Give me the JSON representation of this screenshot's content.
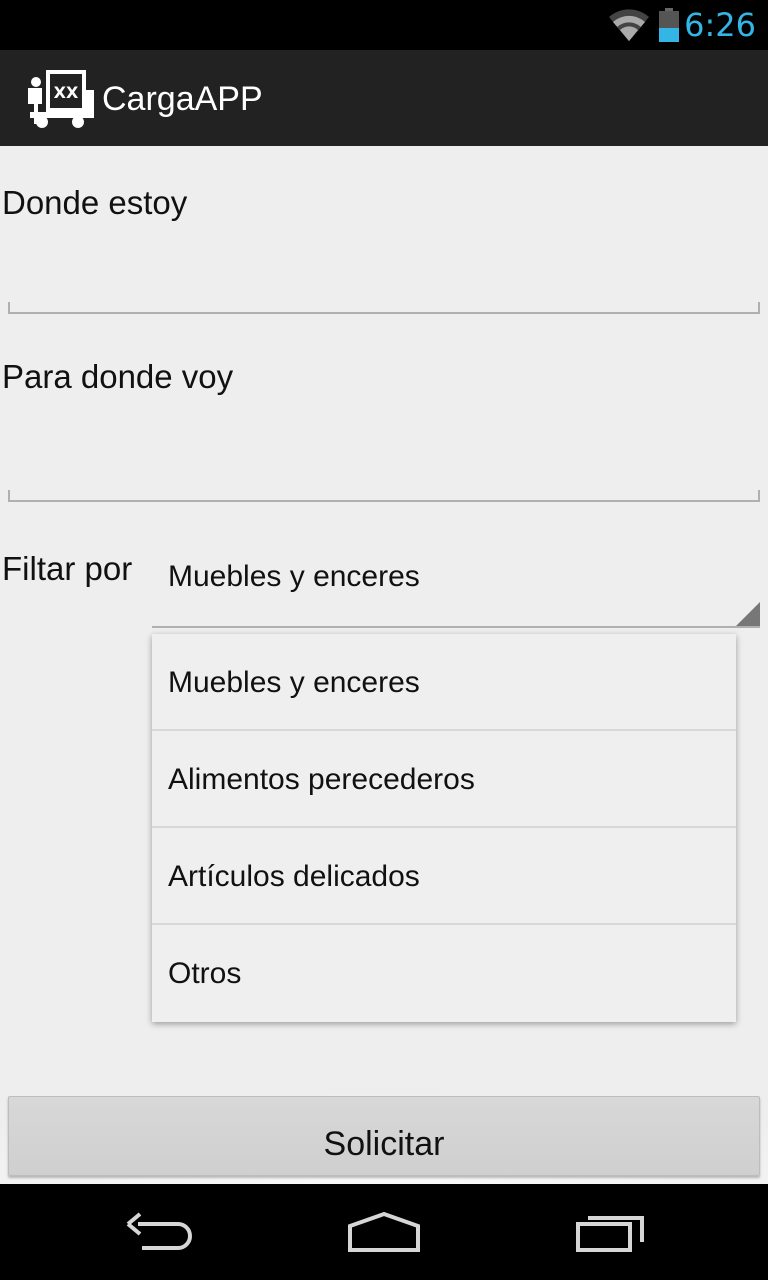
{
  "status_bar": {
    "time": "6:26"
  },
  "app": {
    "title": "CargaAPP",
    "logo_icon": "truck-logo-icon"
  },
  "form": {
    "origin_label": "Donde estoy",
    "origin_value": "",
    "destination_label": "Para donde voy",
    "destination_value": "",
    "filter_label": "Filtar por",
    "filter_selected": "Muebles y enceres",
    "filter_options": [
      "Muebles y enceres",
      "Alimentos perecederos",
      "Artículos delicados",
      "Otros"
    ],
    "submit_label": "Solicitar"
  },
  "nav": {
    "back_icon": "back-icon",
    "home_icon": "home-icon",
    "recents_icon": "recents-icon"
  },
  "colors": {
    "accent": "#33b5e5",
    "action_bar": "#222222",
    "background": "#eeeeee"
  }
}
